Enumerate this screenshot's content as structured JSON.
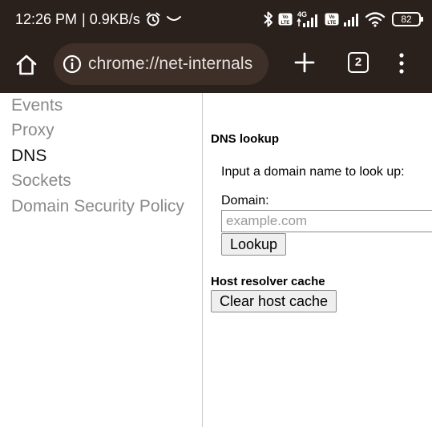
{
  "status_bar": {
    "time": "12:26 PM",
    "data_rate": "| 0.9KB/s",
    "network_label_4g": "4G",
    "volte_label": "Vo\nLTE",
    "battery_level": "82",
    "icons": [
      "alarm-icon",
      "bluetooth-icon",
      "signal-icon",
      "wifi-icon",
      "battery-icon"
    ]
  },
  "toolbar": {
    "url": "chrome://net-internals",
    "tab_count": "2",
    "icons": [
      "home-icon",
      "info-icon",
      "plus-icon",
      "tab-switcher-icon",
      "more-vert-icon"
    ]
  },
  "sidebar": {
    "items": [
      {
        "label": "Events",
        "active": false
      },
      {
        "label": "Proxy",
        "active": false
      },
      {
        "label": "DNS",
        "active": true
      },
      {
        "label": "Sockets",
        "active": false
      },
      {
        "label": "Domain Security Policy",
        "active": false
      }
    ]
  },
  "dns": {
    "lookup_title": "DNS lookup",
    "lookup_prompt": "Input a domain name to look up:",
    "domain_label": "Domain:",
    "domain_value": "",
    "domain_placeholder": "example.com",
    "lookup_button": "Lookup",
    "cache_title": "Host resolver cache",
    "clear_cache_button": "Clear host cache"
  },
  "colors": {
    "chrome_background": "#2b211c",
    "omnibox_background": "#3e2f28",
    "nav_inactive": "#8a8a8a",
    "nav_active": "#111111"
  }
}
